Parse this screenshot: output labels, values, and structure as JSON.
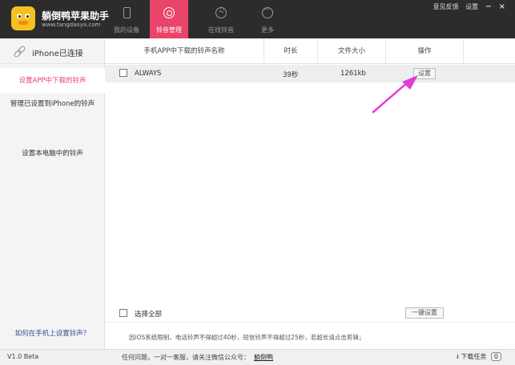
{
  "app": {
    "name": "躺倒鸭苹果助手",
    "url": "www.tangdaoya.com"
  },
  "nav": [
    {
      "label": "我的设备",
      "icon": "phone-icon"
    },
    {
      "label": "铃音管理",
      "icon": "ringtone-icon",
      "active": true
    },
    {
      "label": "在线铃音",
      "icon": "music-icon"
    },
    {
      "label": "更多",
      "icon": "more-icon"
    }
  ],
  "top_links": {
    "feedback": "意见反馈",
    "settings": "设置",
    "minimize": "−",
    "close": "×"
  },
  "sidebar": {
    "connection": "iPhone已连接",
    "items": [
      {
        "label": "设置APP中下载的铃声",
        "active": true
      },
      {
        "label": "管理已设置到iPhone的铃声"
      },
      {
        "label": "设置本电脑中的铃声"
      }
    ],
    "help": "如何在手机上设置铃声？"
  },
  "table": {
    "headers": {
      "name": "手机APP中下载的铃声名称",
      "duration": "时长",
      "size": "文件大小",
      "action": "操作"
    },
    "rows": [
      {
        "name": "ALWAYS",
        "duration": "39秒",
        "size": "1261kb",
        "action": "设置"
      }
    ]
  },
  "bottom": {
    "select_all": "选择全部",
    "one_click": "一键设置",
    "notice": "因iOS系统限制，电话铃声不得超过40秒，短信铃声不得超过25秒，若超长请点击剪辑；"
  },
  "status": {
    "version": "V1.0 Beta",
    "message": "任何问题，一对一客服，请关注微信公众号：",
    "wechat": "躺倒鸭",
    "download": "下载任务",
    "download_count": "0"
  },
  "colors": {
    "accent": "#e9456a",
    "header": "#2c2c2c",
    "arrow": "#e23bd6"
  }
}
